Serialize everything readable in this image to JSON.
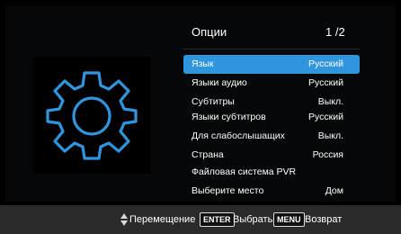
{
  "menu": {
    "title": "Опции",
    "page": "1 /2",
    "items": [
      {
        "label": "Язык",
        "value": "Русский",
        "selected": true
      },
      {
        "label": "Языки аудио",
        "value": "Русский",
        "selected": false
      },
      {
        "label": "Субтитры",
        "value": "Выкл.",
        "selected": false
      },
      {
        "label": "Языки субтитров",
        "value": "Русский",
        "selected": false
      },
      {
        "label": "Для слабослышащих",
        "value": "Выкл.",
        "selected": false
      },
      {
        "label": "Страна",
        "value": "Россия",
        "selected": false
      },
      {
        "label": "Файловая система PVR",
        "value": "",
        "selected": false
      },
      {
        "label": "Выберите место",
        "value": "Дом",
        "selected": false
      }
    ]
  },
  "footer": {
    "move_label": "Перемещение",
    "enter_key": "ENTER",
    "select_label": "Выбрать",
    "menu_key": "MENU",
    "back_label": "Возврат"
  },
  "icons": {
    "settings": "gear-icon",
    "navigation": "up-down-arrows-icon"
  },
  "colors": {
    "accent": "#2f95dd",
    "gear": "#2f95dd"
  }
}
